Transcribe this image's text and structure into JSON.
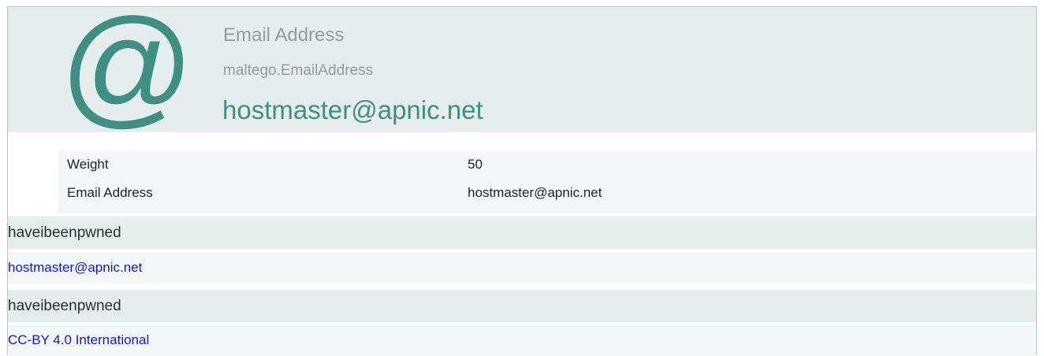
{
  "entity": {
    "icon": "at-sign-icon",
    "icon_glyph": "@",
    "type_label": "Email Address",
    "type_class": "maltego.EmailAddress",
    "value": "hostmaster@apnic.net"
  },
  "properties": [
    {
      "key": "Weight",
      "value": "50"
    },
    {
      "key": "Email Address",
      "value": "hostmaster@apnic.net"
    }
  ],
  "sections": [
    {
      "title": "haveibeenpwned",
      "link": "hostmaster@apnic.net"
    },
    {
      "title": "haveibeenpwned",
      "link": "CC-BY 4.0 International"
    }
  ],
  "colors": {
    "accent": "#3f8f85",
    "header_bg": "#e5eded",
    "link": "#1414d4"
  }
}
